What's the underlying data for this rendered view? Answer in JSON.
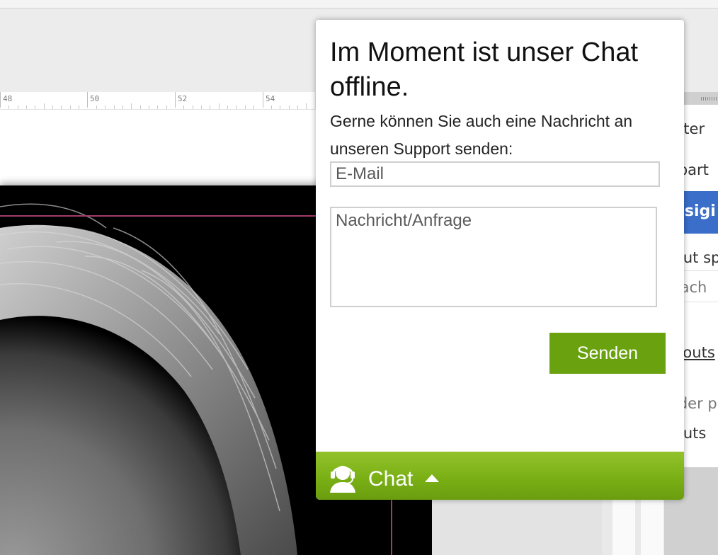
{
  "ruler": {
    "labels": [
      "48",
      "50",
      "52",
      "54"
    ]
  },
  "right_panel": {
    "items": [
      "nter",
      "ipart",
      "esigi",
      "out sp",
      "rach",
      "youts",
      "lder p",
      "outs"
    ]
  },
  "chat": {
    "title": "Im Moment ist unser Chat offline.",
    "message": "Gerne können Sie auch eine Nachricht an unseren Support senden:",
    "email_placeholder": "E-Mail",
    "message_placeholder": "Nachricht/Anfrage",
    "send_label": "Senden",
    "bar_label": "Chat",
    "bar_icon": "chat-support-headset-icon",
    "caret_icon": "caret-up-icon"
  },
  "colors": {
    "send_button": "#6aa10f",
    "chat_bar": "#7ab015",
    "guide_line": "#a33a6a",
    "panel_accent": "#3a6ec9"
  }
}
